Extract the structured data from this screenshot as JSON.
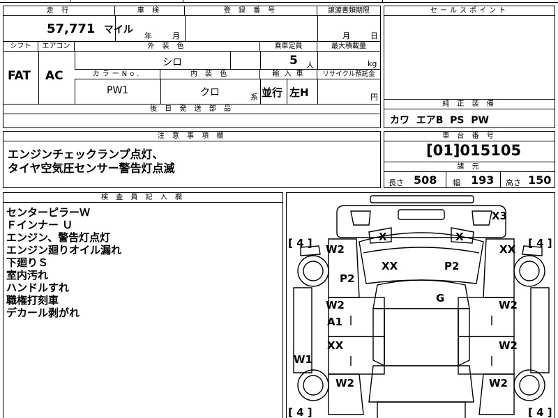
{
  "top_fragments": {
    "left": "",
    "mid": "",
    "right": ""
  },
  "mileage": {
    "header": "走 行",
    "value": "57,771",
    "unit": "マイル"
  },
  "inspection": {
    "header": "車 検",
    "year_unit": "年",
    "month_unit": "月"
  },
  "registration": {
    "header": "登 録 番 号",
    "value": ""
  },
  "transfer_deadline": {
    "header": "譲渡書類期限",
    "month_unit": "月",
    "day_unit": "日"
  },
  "sales_point": {
    "header": "セールスポイント",
    "value": ""
  },
  "shift": {
    "header": "シフト",
    "value": "FAT"
  },
  "aircon": {
    "header": "エアコン",
    "value": "AC"
  },
  "exterior_color": {
    "header": "外 装 色",
    "value": "シロ"
  },
  "capacity": {
    "header": "乗車定員",
    "value": "5",
    "unit": "人"
  },
  "max_load": {
    "header": "最大積載量",
    "unit": "kg"
  },
  "color_no": {
    "header": "カラーNo.",
    "value": "PW1"
  },
  "interior_color": {
    "header": "内 装 色",
    "value": "クロ",
    "unit": "系"
  },
  "import_car": {
    "header": "輸 入 車",
    "drive": "並行",
    "steering": "左H"
  },
  "recycle_fee": {
    "header": "リサイクル預託金",
    "unit": "円"
  },
  "later_parts": {
    "header": "後 日 発 送 部 品",
    "value": ""
  },
  "genuine_equipment": {
    "header": "純 正 装 備",
    "value": "カワ  エアB  PS  PW"
  },
  "notes": {
    "header": "注 意 事 項 欄",
    "lines": [
      "エンジンチェックランプ点灯、",
      "タイヤ空気圧センサー警告灯点滅"
    ]
  },
  "chassis": {
    "header": "車 台 番 号",
    "value": "[01]015105"
  },
  "dimensions": {
    "header": "諸 元",
    "length_label": "長さ",
    "length": "508",
    "width_label": "幅",
    "width": "193",
    "height_label": "高さ",
    "height": "150"
  },
  "inspector": {
    "header": "検 査 員 記 入 欄",
    "lines": [
      "センターピラーＷ",
      "Ｆインナー Ｕ",
      "エンジン、警告灯点灯",
      "エンジン廻りオイル漏れ",
      "下廻りＳ",
      "室内汚れ",
      "ハンドルすれ",
      "職権打刻車",
      "デカール剥がれ"
    ]
  },
  "diagram": {
    "tires": {
      "front_left": "[ 4 ]",
      "front_right": "[ 4 ]",
      "rear_left": "[ 4 ]",
      "rear_right": "[ 4 ]"
    },
    "marks": [
      "X3",
      "X",
      "X",
      "W2",
      "XX",
      "XX",
      "P2",
      "P2",
      "G",
      "W2",
      "W2",
      "A1",
      "XX",
      "W2",
      "W1",
      "W2",
      "W2"
    ]
  }
}
